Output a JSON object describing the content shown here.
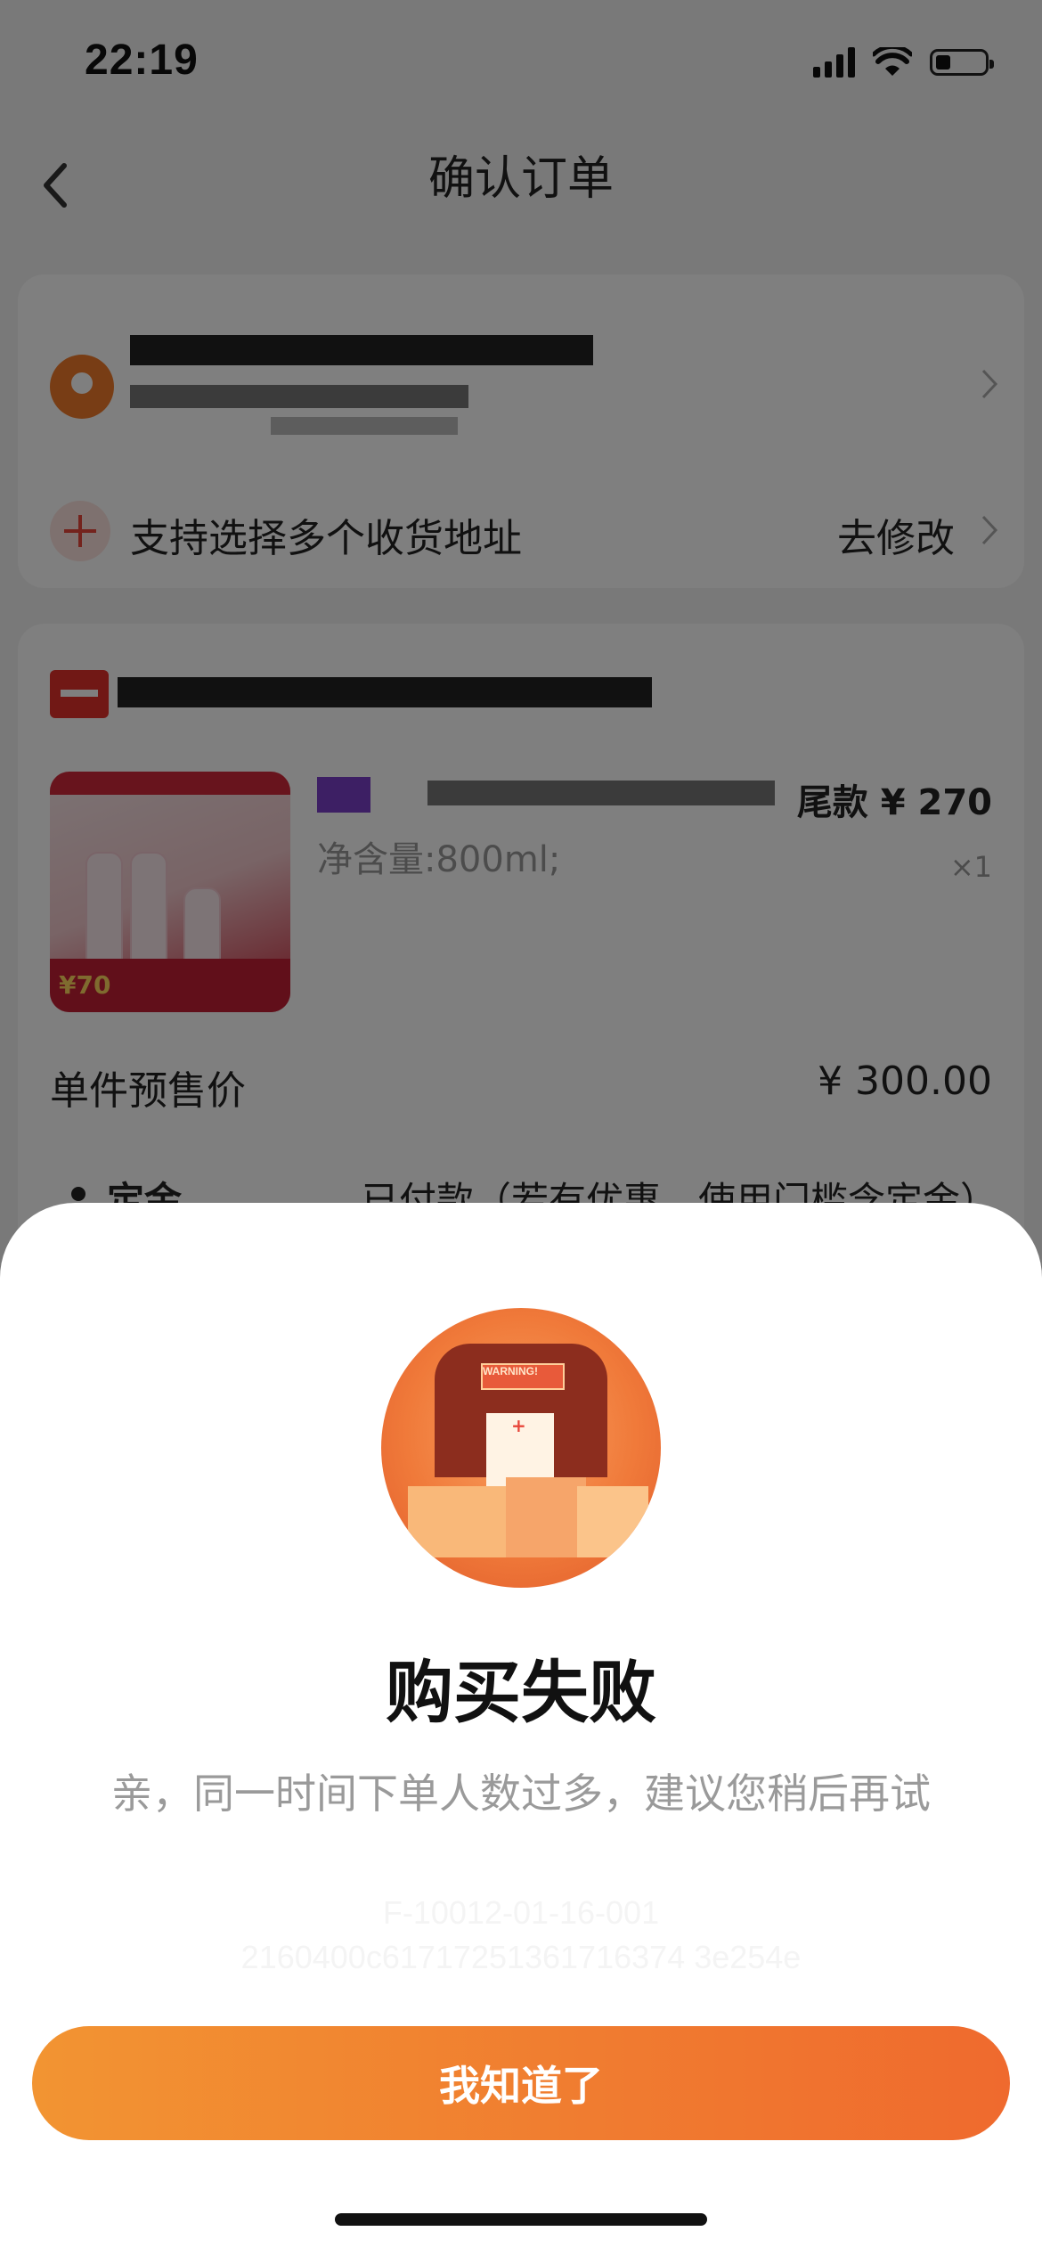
{
  "status_bar": {
    "time": "22:19"
  },
  "nav": {
    "title": "确认订单"
  },
  "address": {
    "multi_label": "支持选择多个收货地址",
    "modify_label": "去修改"
  },
  "item": {
    "spec": "净含量:800ml;",
    "tail_price": "尾款 ¥ 270",
    "quantity": "×1",
    "image_price": "¥70",
    "unit_price_label": "单件预售价",
    "unit_price_value": "¥ 300.00",
    "deposit_label": "定金",
    "deposit_note": "已付款（若有优惠，使用门槛含定金）"
  },
  "dialog": {
    "image_text": "WARNING!",
    "title": "购买失败",
    "message": "亲，同一时间下单人数过多，建议您稍后再试",
    "code_line1": "F-10012-01-16-001",
    "code_line2": "2160400c61717251361716374 3e254e",
    "button_label": "我知道了"
  }
}
